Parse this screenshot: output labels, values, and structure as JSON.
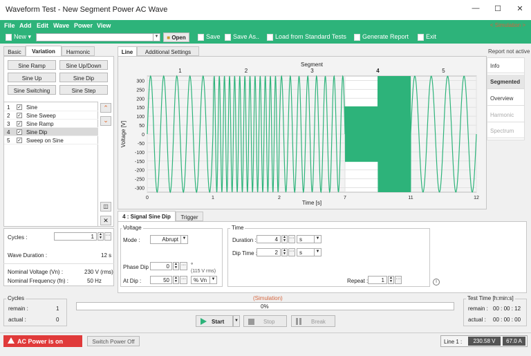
{
  "window": {
    "title": "Waveform Test - New Segment Power AC Wave"
  },
  "menu": [
    "File",
    "Add",
    "Edit",
    "Wave",
    "Power",
    "View"
  ],
  "mode": "< Simulation >",
  "toolbar": {
    "new": "New",
    "open": "Open",
    "save": "Save",
    "save_as": "Save As..",
    "load": "Load from Standard Tests",
    "report": "Generate Report",
    "exit": "Exit"
  },
  "left_tabs": [
    "Basic",
    "Variation",
    "Harmonic"
  ],
  "variation_buttons": [
    "Sine Ramp",
    "Sine Up/Down",
    "Sine Up",
    "Sine Dip",
    "Sine Switching",
    "Sine Step"
  ],
  "segments": [
    {
      "num": "1",
      "label": "Sine"
    },
    {
      "num": "2",
      "label": "Sine Sweep"
    },
    {
      "num": "3",
      "label": "Sine Ramp"
    },
    {
      "num": "4",
      "label": "Sine Dip"
    },
    {
      "num": "5",
      "label": "Sweep on Sine"
    }
  ],
  "cycles": {
    "label": "Cycles :",
    "value": "1"
  },
  "wave_duration": {
    "label": "Wave Duration :",
    "value": "12 s"
  },
  "nominal_voltage": {
    "label": "Nominal Voltage (Vn) :",
    "value": "230 V (rms)"
  },
  "nominal_frequency": {
    "label": "Nominal Frequency (fn) :",
    "value": "50 Hz"
  },
  "chart_tabs": [
    "Line",
    "Additional Settings"
  ],
  "report_status": "Report not active",
  "side_tabs": [
    "Info",
    "Segmented",
    "Overview",
    "Harmonic",
    "Spectrum"
  ],
  "chart_data": {
    "type": "line",
    "title": "Segment",
    "xlabel": "Time [s]",
    "ylabel": "Voltage [V]",
    "ylim": [
      -325,
      325
    ],
    "yticks": [
      300,
      250,
      200,
      150,
      100,
      50,
      0,
      -50,
      -100,
      -150,
      -200,
      -250,
      -300
    ],
    "xticks": [
      0,
      1,
      2,
      7,
      11,
      12
    ],
    "segment_labels": [
      "1",
      "2",
      "3",
      "4",
      "5"
    ],
    "highlighted_segment": "4",
    "series": [
      {
        "color": "#2db37a",
        "segments": [
          {
            "t0": 0,
            "t1": 1,
            "freq_hz": 5,
            "amplitude": 325
          },
          {
            "t0": 1,
            "t1": 2,
            "freq_hz": 13,
            "amplitude": 325
          },
          {
            "t0": 2,
            "t1": 7,
            "freq_hz": 1.5,
            "amplitude": 325
          },
          {
            "t0": 7,
            "t1": 11,
            "freq_hz": 30,
            "amplitude": 155,
            "dip_until": 9,
            "amplitude_after_dip": 325
          },
          {
            "t0": 11,
            "t1": 12,
            "freq_hz": 4,
            "amplitude": 325
          }
        ]
      }
    ]
  },
  "detail_tabs": [
    "4 : Signal Sine Dip",
    "Trigger"
  ],
  "voltage_group": {
    "title": "Voltage",
    "mode_label": "Mode :",
    "mode_value": "Abrupt",
    "phase_dip_label": "Phase Dip :",
    "phase_dip_value": "0",
    "phase_dip_unit": "°",
    "at_dip_label": "At Dip :",
    "at_dip_value": "50",
    "at_dip_unit": "% Vn",
    "hint": "(115 V rms)"
  },
  "time_group": {
    "title": "Time",
    "duration_label": "Duration :",
    "duration_value": "4",
    "duration_unit": "s",
    "dip_time_label": "Dip Time :",
    "dip_time_value": "2",
    "dip_time_unit": "s",
    "repeat_label": "Repeat :",
    "repeat_value": "1"
  },
  "cycles_group": {
    "title": "Cycles",
    "remain_label": "remain :",
    "remain_value": "1",
    "actual_label": "actual :",
    "actual_value": "0"
  },
  "progress": {
    "status": "(Simulation)",
    "text": "0%",
    "value": 0
  },
  "run_buttons": {
    "start": "Start",
    "stop": "Stop",
    "break": "Break"
  },
  "test_time": {
    "title": "Test Time [h:min:s]",
    "remain_label": "remain :",
    "remain_value": "00 : 00 : 12",
    "actual_label": "actual :",
    "actual_value": "00 : 00 : 00"
  },
  "status_bar": {
    "ac_power": "AC Power is on",
    "switch_power": "Switch Power Off",
    "line_label": "Line 1 :",
    "line_voltage": "230.58 V",
    "line_current": "67.0 A"
  }
}
